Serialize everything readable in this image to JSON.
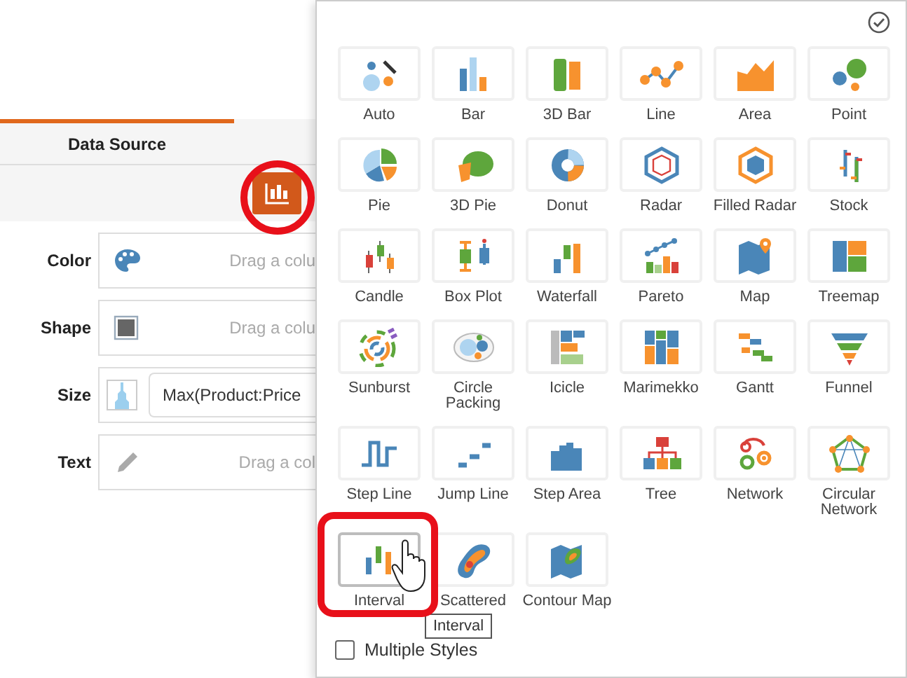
{
  "left_panel": {
    "tab": {
      "label": "Data Source",
      "selected": true
    },
    "bindings": [
      {
        "label": "Color",
        "kind": "drop",
        "placeholder": "Drag a colu"
      },
      {
        "label": "Shape",
        "kind": "drop",
        "placeholder": "Drag a colu"
      },
      {
        "label": "Size",
        "kind": "value",
        "value": "Max(Product:Price"
      },
      {
        "label": "Text",
        "kind": "drop",
        "placeholder": "Drag a col"
      }
    ]
  },
  "chart_picker": {
    "types": [
      {
        "label": "Auto",
        "selected": false
      },
      {
        "label": "Bar",
        "selected": false
      },
      {
        "label": "3D Bar",
        "selected": false
      },
      {
        "label": "Line",
        "selected": false
      },
      {
        "label": "Area",
        "selected": false
      },
      {
        "label": "Point",
        "selected": false
      },
      {
        "label": "Pie",
        "selected": false
      },
      {
        "label": "3D Pie",
        "selected": false
      },
      {
        "label": "Donut",
        "selected": false
      },
      {
        "label": "Radar",
        "selected": false
      },
      {
        "label": "Filled Radar",
        "selected": false
      },
      {
        "label": "Stock",
        "selected": false
      },
      {
        "label": "Candle",
        "selected": false
      },
      {
        "label": "Box Plot",
        "selected": false
      },
      {
        "label": "Waterfall",
        "selected": false
      },
      {
        "label": "Pareto",
        "selected": false
      },
      {
        "label": "Map",
        "selected": false
      },
      {
        "label": "Treemap",
        "selected": false
      },
      {
        "label": "Sunburst",
        "selected": false
      },
      {
        "label": "Circle Packing",
        "selected": false
      },
      {
        "label": "Icicle",
        "selected": false
      },
      {
        "label": "Marimekko",
        "selected": false
      },
      {
        "label": "Gantt",
        "selected": false
      },
      {
        "label": "Funnel",
        "selected": false
      },
      {
        "label": "Step Line",
        "selected": false
      },
      {
        "label": "Jump Line",
        "selected": false
      },
      {
        "label": "Step Area",
        "selected": false
      },
      {
        "label": "Tree",
        "selected": false
      },
      {
        "label": "Network",
        "selected": false
      },
      {
        "label": "Circular Network",
        "selected": false
      },
      {
        "label": "Interval",
        "selected": true
      },
      {
        "label": "Scattered",
        "selected": false
      },
      {
        "label": "Contour Map",
        "selected": false
      }
    ],
    "tooltip": "Interval",
    "multiple_styles": {
      "label": "Multiple Styles",
      "checked": false
    }
  }
}
